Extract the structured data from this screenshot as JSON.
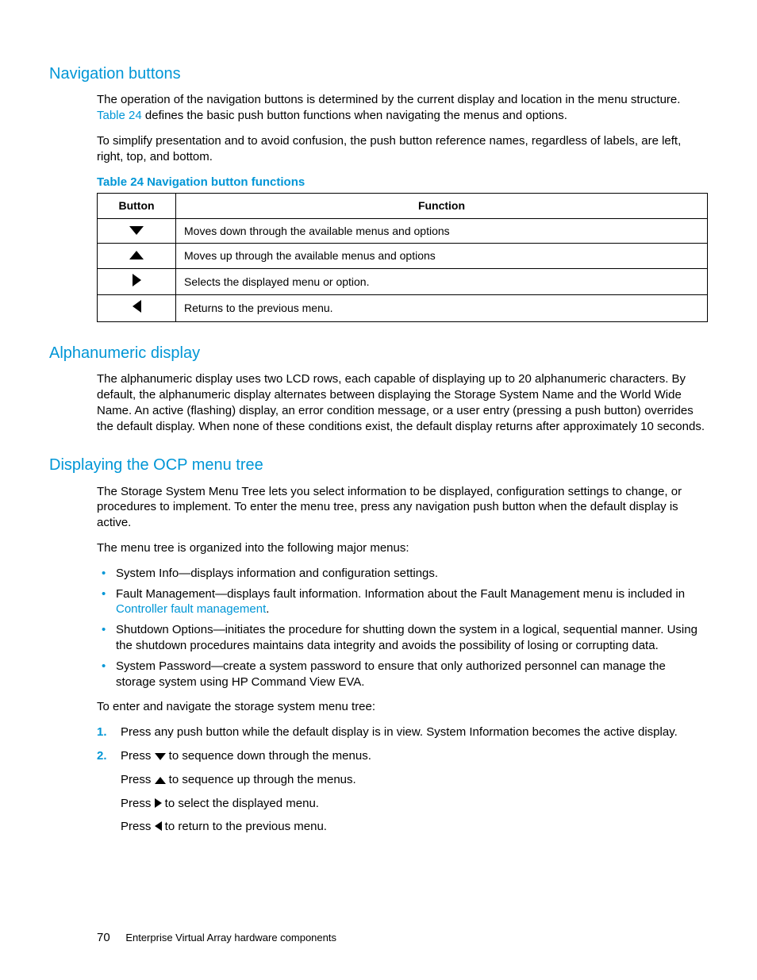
{
  "sec1": {
    "heading": "Navigation buttons",
    "p1a": "The operation of the navigation buttons is determined by the current display and location in the menu structure. ",
    "p1link": "Table 24",
    "p1b": " defines the basic push button functions when navigating the menus and options.",
    "p2": "To simplify presentation and to avoid confusion, the push button reference names, regardless of labels, are left, right, top, and bottom.",
    "tableCaption": "Table 24 Navigation button functions",
    "th1": "Button",
    "th2": "Function",
    "row1": "Moves down through the available menus and options",
    "row2": "Moves up through the available menus and options",
    "row3": "Selects the displayed menu or option.",
    "row4": "Returns to the previous menu."
  },
  "sec2": {
    "heading": "Alphanumeric display",
    "p1": "The alphanumeric display uses two LCD rows, each capable of displaying up to 20 alphanumeric characters. By default, the alphanumeric display alternates between displaying the Storage System Name and the World Wide Name. An active (flashing) display, an error condition message, or a user entry (pressing a push button) overrides the default display. When none of these conditions exist, the default display returns after approximately 10 seconds."
  },
  "sec3": {
    "heading": "Displaying the OCP menu tree",
    "p1": "The Storage System Menu Tree lets you select information to be displayed, configuration settings to change, or procedures to implement. To enter the menu tree, press any navigation push button when the default display is active.",
    "p2": "The menu tree is organized into the following major menus:",
    "b1": "System Info—displays information and configuration settings.",
    "b2a": "Fault Management—displays fault information. Information about the Fault Management menu is included in ",
    "b2link": "Controller fault management",
    "b2b": ".",
    "b3": "Shutdown Options—initiates the procedure for shutting down the system in a logical, sequential manner. Using the shutdown procedures maintains data integrity and avoids the possibility of losing or corrupting data.",
    "b4": "System Password—create a system password to ensure that only authorized personnel can manage the storage system using HP Command View EVA.",
    "p3": "To enter and navigate the storage system menu tree:",
    "s1": "Press any push button while the default display is in view. System Information becomes the active display.",
    "s2a": "Press ",
    "s2b": " to sequence down through the menus.",
    "s2suba": "Press ",
    "s2subb": " to sequence up through the menus.",
    "s2subc": " to select the displayed menu.",
    "s2subd": " to return to the previous menu."
  },
  "footer": {
    "pagenum": "70",
    "text": "Enterprise Virtual Array hardware components"
  }
}
